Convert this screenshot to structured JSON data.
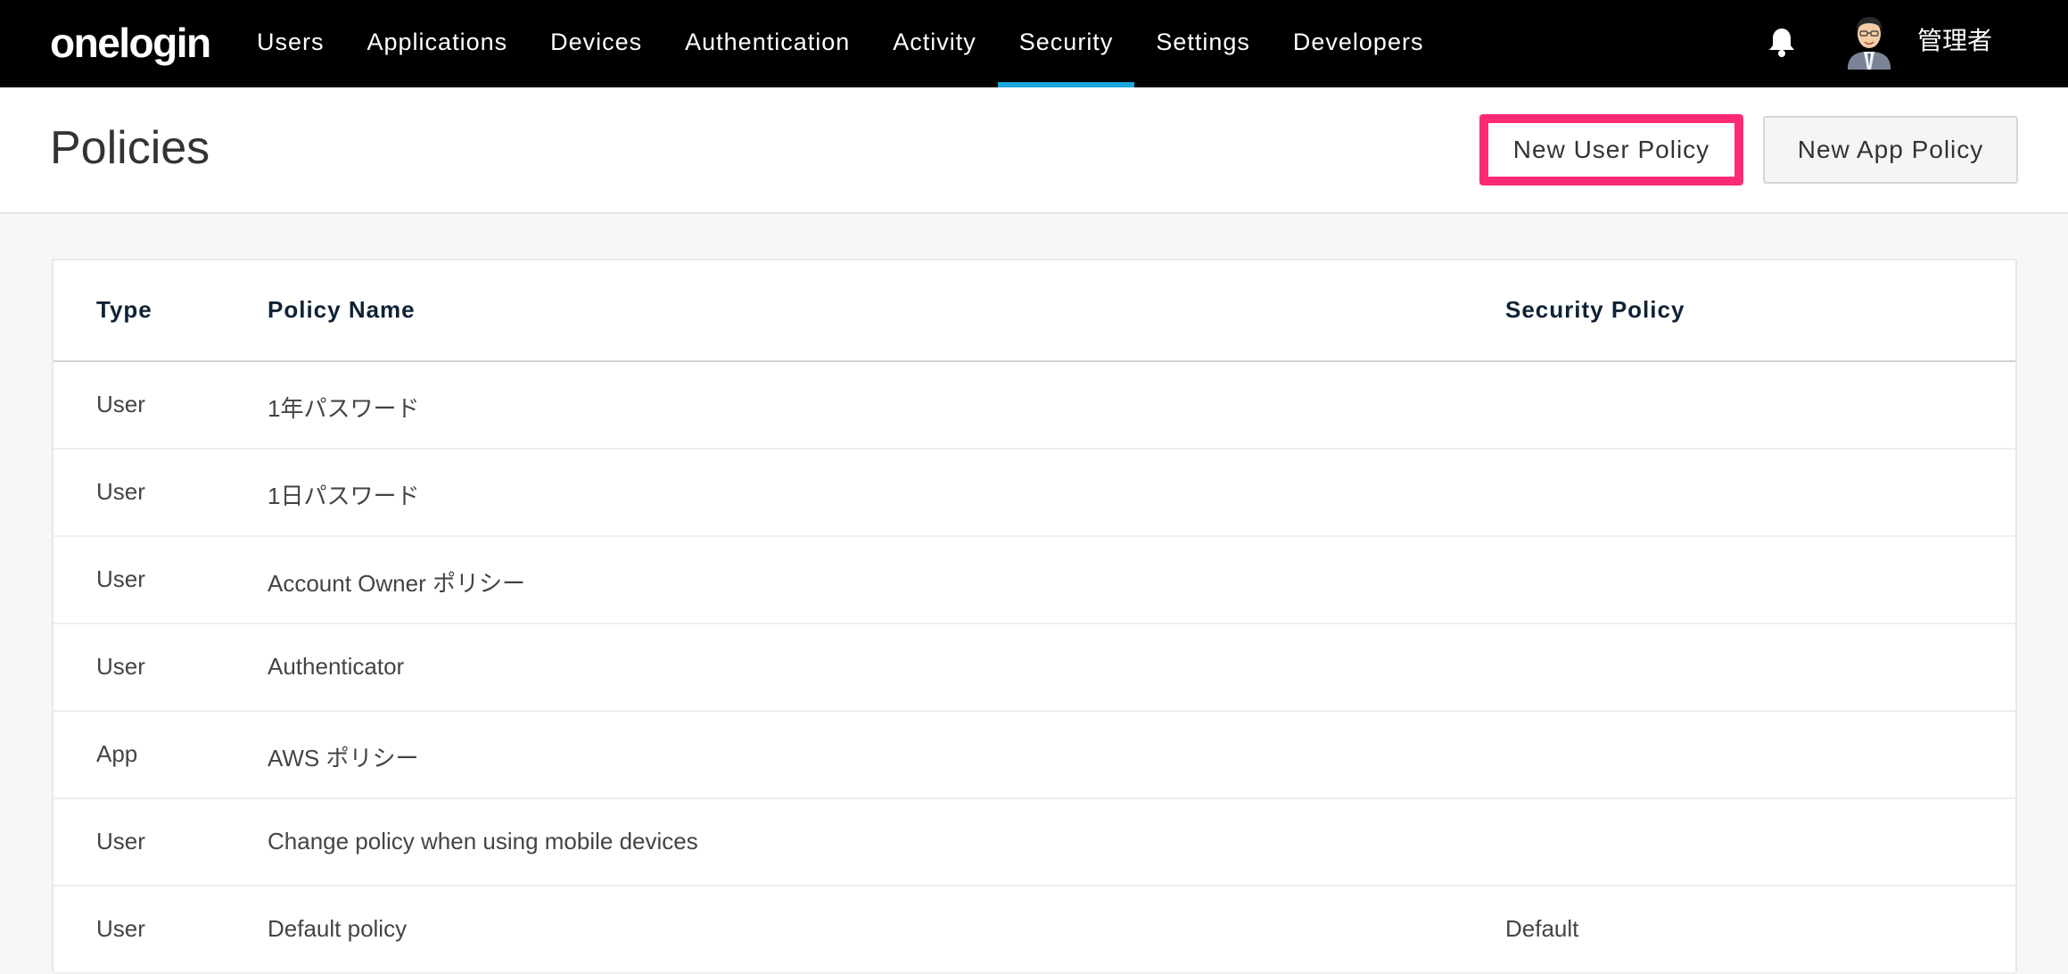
{
  "app": {
    "logo_text": "onelogin",
    "user_name": "管理者"
  },
  "nav": {
    "items": [
      {
        "label": "Users",
        "active": false
      },
      {
        "label": "Applications",
        "active": false
      },
      {
        "label": "Devices",
        "active": false
      },
      {
        "label": "Authentication",
        "active": false
      },
      {
        "label": "Activity",
        "active": false
      },
      {
        "label": "Security",
        "active": true
      },
      {
        "label": "Settings",
        "active": false
      },
      {
        "label": "Developers",
        "active": false
      }
    ]
  },
  "icons": {
    "notifications": "bell-icon",
    "avatar": "user-avatar"
  },
  "page": {
    "title": "Policies",
    "new_user_policy_label": "New User Policy",
    "new_app_policy_label": "New App Policy",
    "highlight_color": "#ff2a75",
    "accent_color": "#19a7dc"
  },
  "table": {
    "headers": {
      "type": "Type",
      "policy_name": "Policy Name",
      "security_policy": "Security Policy"
    },
    "rows": [
      {
        "type": "User",
        "name": "1年パスワード",
        "security": ""
      },
      {
        "type": "User",
        "name": "1日パスワード",
        "security": ""
      },
      {
        "type": "User",
        "name": "Account Owner ポリシー",
        "security": ""
      },
      {
        "type": "User",
        "name": "Authenticator",
        "security": ""
      },
      {
        "type": "App",
        "name": "AWS ポリシー",
        "security": ""
      },
      {
        "type": "User",
        "name": "Change policy when using mobile devices",
        "security": ""
      },
      {
        "type": "User",
        "name": "Default policy",
        "security": "Default"
      }
    ]
  }
}
